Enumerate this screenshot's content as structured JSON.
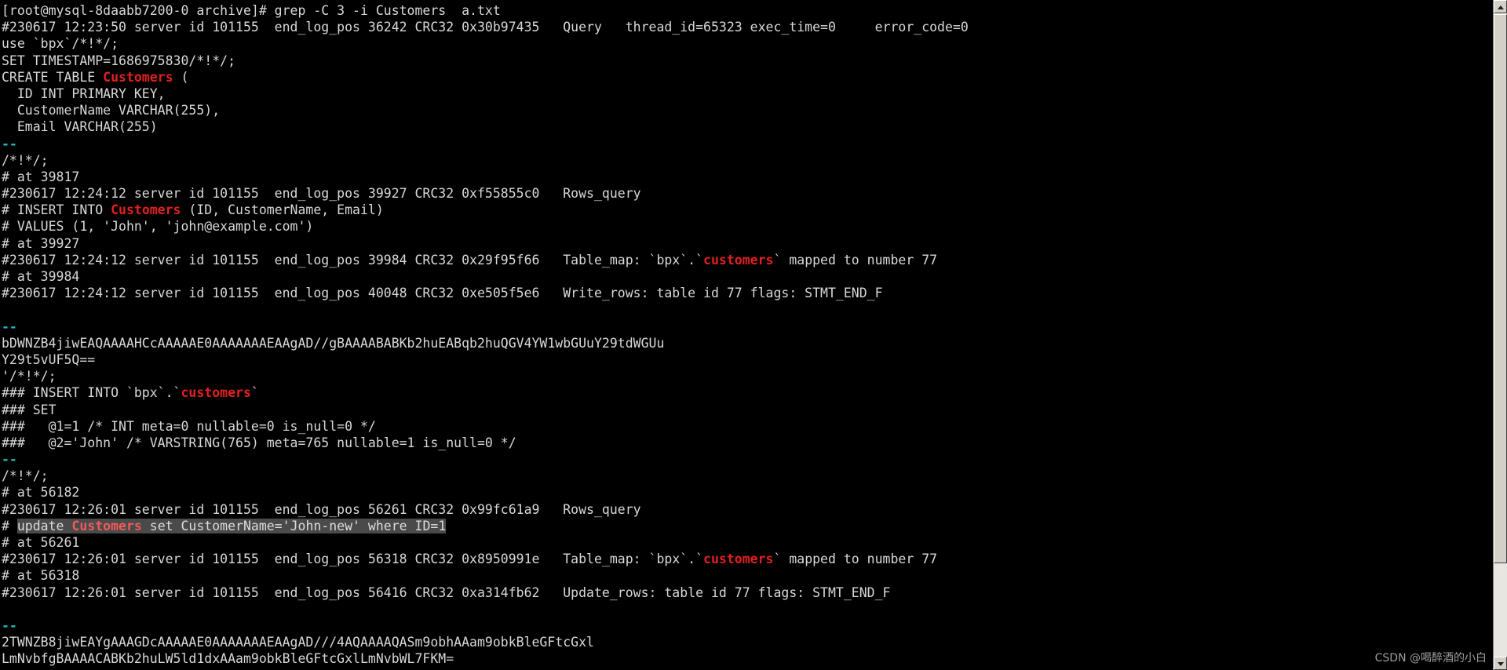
{
  "terminal": {
    "title": "root@mysql-8daabb7200-0:archive",
    "background_color": "#000000",
    "foreground_color": "#d8d8d8",
    "match_color": "#e02020",
    "separator_color": "#22b8b8",
    "selection_background": "#4a4a4a",
    "prompt": "[root@mysql-8daabb7200-0 archive]# ",
    "command": "grep -C 3 -i Customers  a.txt",
    "scrollbar": {
      "up_arrow": "scroll-up-arrow",
      "down_arrow": "scroll-down-arrow"
    },
    "watermark": "CSDN @喝醉酒的小白"
  },
  "lines": [
    {
      "id": 0,
      "segments": [
        {
          "t": "[root@mysql-8daabb7200-0 archive]# grep -C 3 -i Customers  a.txt",
          "c": "default"
        }
      ]
    },
    {
      "id": 1,
      "segments": [
        {
          "t": "#230617 12:23:50 server id 101155  end_log_pos 36242 CRC32 0x30b97435   Query   thread_id=65323 exec_time=0     error_code=0",
          "c": "default"
        }
      ]
    },
    {
      "id": 2,
      "segments": [
        {
          "t": "use `bpx`/*!*/;",
          "c": "default"
        }
      ]
    },
    {
      "id": 3,
      "segments": [
        {
          "t": "SET TIMESTAMP=1686975830/*!*/;",
          "c": "default"
        }
      ]
    },
    {
      "id": 4,
      "segments": [
        {
          "t": "CREATE TABLE ",
          "c": "default"
        },
        {
          "t": "Customers",
          "c": "match"
        },
        {
          "t": " (",
          "c": "default"
        }
      ]
    },
    {
      "id": 5,
      "segments": [
        {
          "t": "  ID INT PRIMARY KEY,",
          "c": "default"
        }
      ]
    },
    {
      "id": 6,
      "segments": [
        {
          "t": "  CustomerName VARCHAR(255),",
          "c": "default"
        }
      ]
    },
    {
      "id": 7,
      "segments": [
        {
          "t": "  Email VARCHAR(255)",
          "c": "default"
        }
      ]
    },
    {
      "id": 8,
      "segments": [
        {
          "t": "--",
          "c": "sep"
        }
      ]
    },
    {
      "id": 9,
      "segments": [
        {
          "t": "/*!*/;",
          "c": "default"
        }
      ]
    },
    {
      "id": 10,
      "segments": [
        {
          "t": "# at 39817",
          "c": "default"
        }
      ]
    },
    {
      "id": 11,
      "segments": [
        {
          "t": "#230617 12:24:12 server id 101155  end_log_pos 39927 CRC32 0xf55855c0   Rows_query",
          "c": "default"
        }
      ]
    },
    {
      "id": 12,
      "segments": [
        {
          "t": "# INSERT INTO ",
          "c": "default"
        },
        {
          "t": "Customers",
          "c": "match"
        },
        {
          "t": " (ID, CustomerName, Email)",
          "c": "default"
        }
      ]
    },
    {
      "id": 13,
      "segments": [
        {
          "t": "# VALUES (1, 'John', 'john@example.com')",
          "c": "default"
        }
      ]
    },
    {
      "id": 14,
      "segments": [
        {
          "t": "# at 39927",
          "c": "default"
        }
      ]
    },
    {
      "id": 15,
      "segments": [
        {
          "t": "#230617 12:24:12 server id 101155  end_log_pos 39984 CRC32 0x29f95f66   Table_map: `bpx`.`",
          "c": "default"
        },
        {
          "t": "customers",
          "c": "match"
        },
        {
          "t": "` mapped to number 77",
          "c": "default"
        }
      ]
    },
    {
      "id": 16,
      "segments": [
        {
          "t": "# at 39984",
          "c": "default"
        }
      ]
    },
    {
      "id": 17,
      "segments": [
        {
          "t": "#230617 12:24:12 server id 101155  end_log_pos 40048 CRC32 0xe505f5e6   Write_rows: table id 77 flags: STMT_END_F",
          "c": "default"
        }
      ]
    },
    {
      "id": 18,
      "segments": [
        {
          "t": "",
          "c": "default"
        }
      ]
    },
    {
      "id": 19,
      "segments": [
        {
          "t": "--",
          "c": "sep"
        }
      ]
    },
    {
      "id": 20,
      "segments": [
        {
          "t": "bDWNZB4jiwEAQAAAAHCcAAAAAE0AAAAAAAEAAgAD//gBAAAABABKb2huEABqb2huQGV4YW1wbGUuY29tdWGUu",
          "c": "default"
        }
      ]
    },
    {
      "id": 21,
      "segments": [
        {
          "t": "Y29t5vUF5Q==",
          "c": "default"
        }
      ]
    },
    {
      "id": 22,
      "segments": [
        {
          "t": "'/*!*/;",
          "c": "default"
        }
      ]
    },
    {
      "id": 23,
      "segments": [
        {
          "t": "### INSERT INTO `bpx`.`",
          "c": "default"
        },
        {
          "t": "customers",
          "c": "match"
        },
        {
          "t": "`",
          "c": "default"
        }
      ]
    },
    {
      "id": 24,
      "segments": [
        {
          "t": "### SET",
          "c": "default"
        }
      ]
    },
    {
      "id": 25,
      "segments": [
        {
          "t": "###   @1=1 /* INT meta=0 nullable=0 is_null=0 */",
          "c": "default"
        }
      ]
    },
    {
      "id": 26,
      "segments": [
        {
          "t": "###   @2='John' /* VARSTRING(765) meta=765 nullable=1 is_null=0 */",
          "c": "default"
        }
      ]
    },
    {
      "id": 27,
      "segments": [
        {
          "t": "--",
          "c": "sep"
        }
      ]
    },
    {
      "id": 28,
      "segments": [
        {
          "t": "/*!*/;",
          "c": "default"
        }
      ]
    },
    {
      "id": 29,
      "segments": [
        {
          "t": "# at 56182",
          "c": "default"
        }
      ]
    },
    {
      "id": 30,
      "segments": [
        {
          "t": "#230617 12:26:01 server id 101155  end_log_pos 56261 CRC32 0x99fc61a9   Rows_query",
          "c": "default"
        }
      ]
    },
    {
      "id": 31,
      "selected": true,
      "segments": [
        {
          "t": "# ",
          "c": "default"
        },
        {
          "t": "update ",
          "c": "sel"
        },
        {
          "t": "Customers",
          "c": "sel-match"
        },
        {
          "t": " set CustomerName='John-new' where ID=1",
          "c": "sel"
        }
      ]
    },
    {
      "id": 32,
      "segments": [
        {
          "t": "# at 56261",
          "c": "default"
        }
      ]
    },
    {
      "id": 33,
      "segments": [
        {
          "t": "#230617 12:26:01 server id 101155  end_log_pos 56318 CRC32 0x8950991e   Table_map: `bpx`.`",
          "c": "default"
        },
        {
          "t": "customers",
          "c": "match"
        },
        {
          "t": "` mapped to number 77",
          "c": "default"
        }
      ]
    },
    {
      "id": 34,
      "segments": [
        {
          "t": "# at 56318",
          "c": "default"
        }
      ]
    },
    {
      "id": 35,
      "segments": [
        {
          "t": "#230617 12:26:01 server id 101155  end_log_pos 56416 CRC32 0xa314fb62   Update_rows: table id 77 flags: STMT_END_F",
          "c": "default"
        }
      ]
    },
    {
      "id": 36,
      "segments": [
        {
          "t": "",
          "c": "default"
        }
      ]
    },
    {
      "id": 37,
      "segments": [
        {
          "t": "--",
          "c": "sep"
        }
      ]
    },
    {
      "id": 38,
      "segments": [
        {
          "t": "2TWNZB8jiwEAYgAAAGDcAAAAAE0AAAAAAAEAAgAD///4AQAAAAQASm9obhAAam9obkBleGFtcGxl",
          "c": "default"
        }
      ]
    },
    {
      "id": 39,
      "segments": [
        {
          "t": "LmNvbfgBAAAACABKb2huLW5ld1dxAAam9obkBleGFtcGxlLmNvbWL7FKM=",
          "c": "default"
        }
      ]
    }
  ]
}
